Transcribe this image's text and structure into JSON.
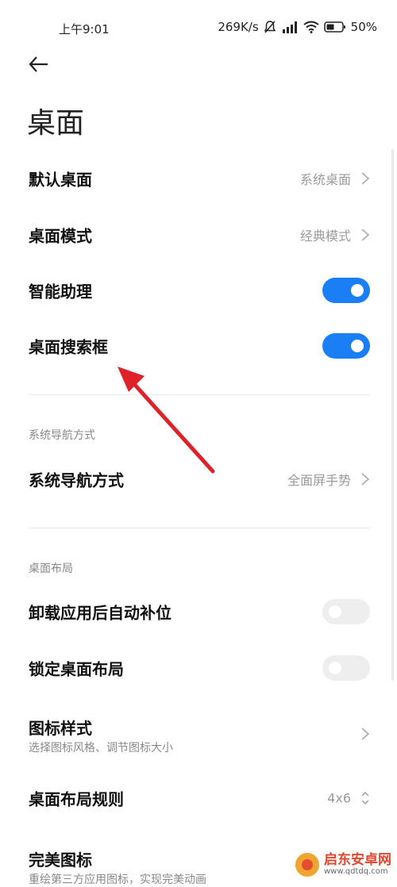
{
  "status_bar": {
    "time": "上午9:01",
    "network_speed": "269K/s",
    "battery": "50%",
    "icons": [
      "mute-bell-icon",
      "hd-signal-icon",
      "wifi-icon",
      "battery-icon"
    ]
  },
  "page": {
    "title": "桌面"
  },
  "rows_top": [
    {
      "label": "默认桌面",
      "value": "系统桌面",
      "type": "chevron"
    },
    {
      "label": "桌面模式",
      "value": "经典模式",
      "type": "chevron"
    },
    {
      "label": "智能助理",
      "type": "toggle",
      "on": true
    },
    {
      "label": "桌面搜索框",
      "type": "toggle",
      "on": true
    }
  ],
  "section_nav": {
    "title": "系统导航方式",
    "row": {
      "label": "系统导航方式",
      "value": "全面屏手势"
    }
  },
  "section_layout": {
    "title": "桌面布局",
    "rows": [
      {
        "label": "卸载应用后自动补位",
        "type": "toggle",
        "on": false
      },
      {
        "label": "锁定桌面布局",
        "type": "toggle",
        "on": false
      },
      {
        "label": "图标样式",
        "sub": "选择图标风格、调节图标大小",
        "type": "chevron"
      },
      {
        "label": "桌面布局规则",
        "value": "4x6",
        "type": "updown"
      },
      {
        "label": "完美图标",
        "sub": "重绘第三方应用图标，实现完美动画",
        "type": "toggle",
        "on": false
      }
    ]
  },
  "watermark": {
    "name": "启东安卓网",
    "url": "www.qdtdq.com"
  },
  "colors": {
    "accent": "#1a7ff5",
    "annotation_arrow": "#e0212a"
  }
}
